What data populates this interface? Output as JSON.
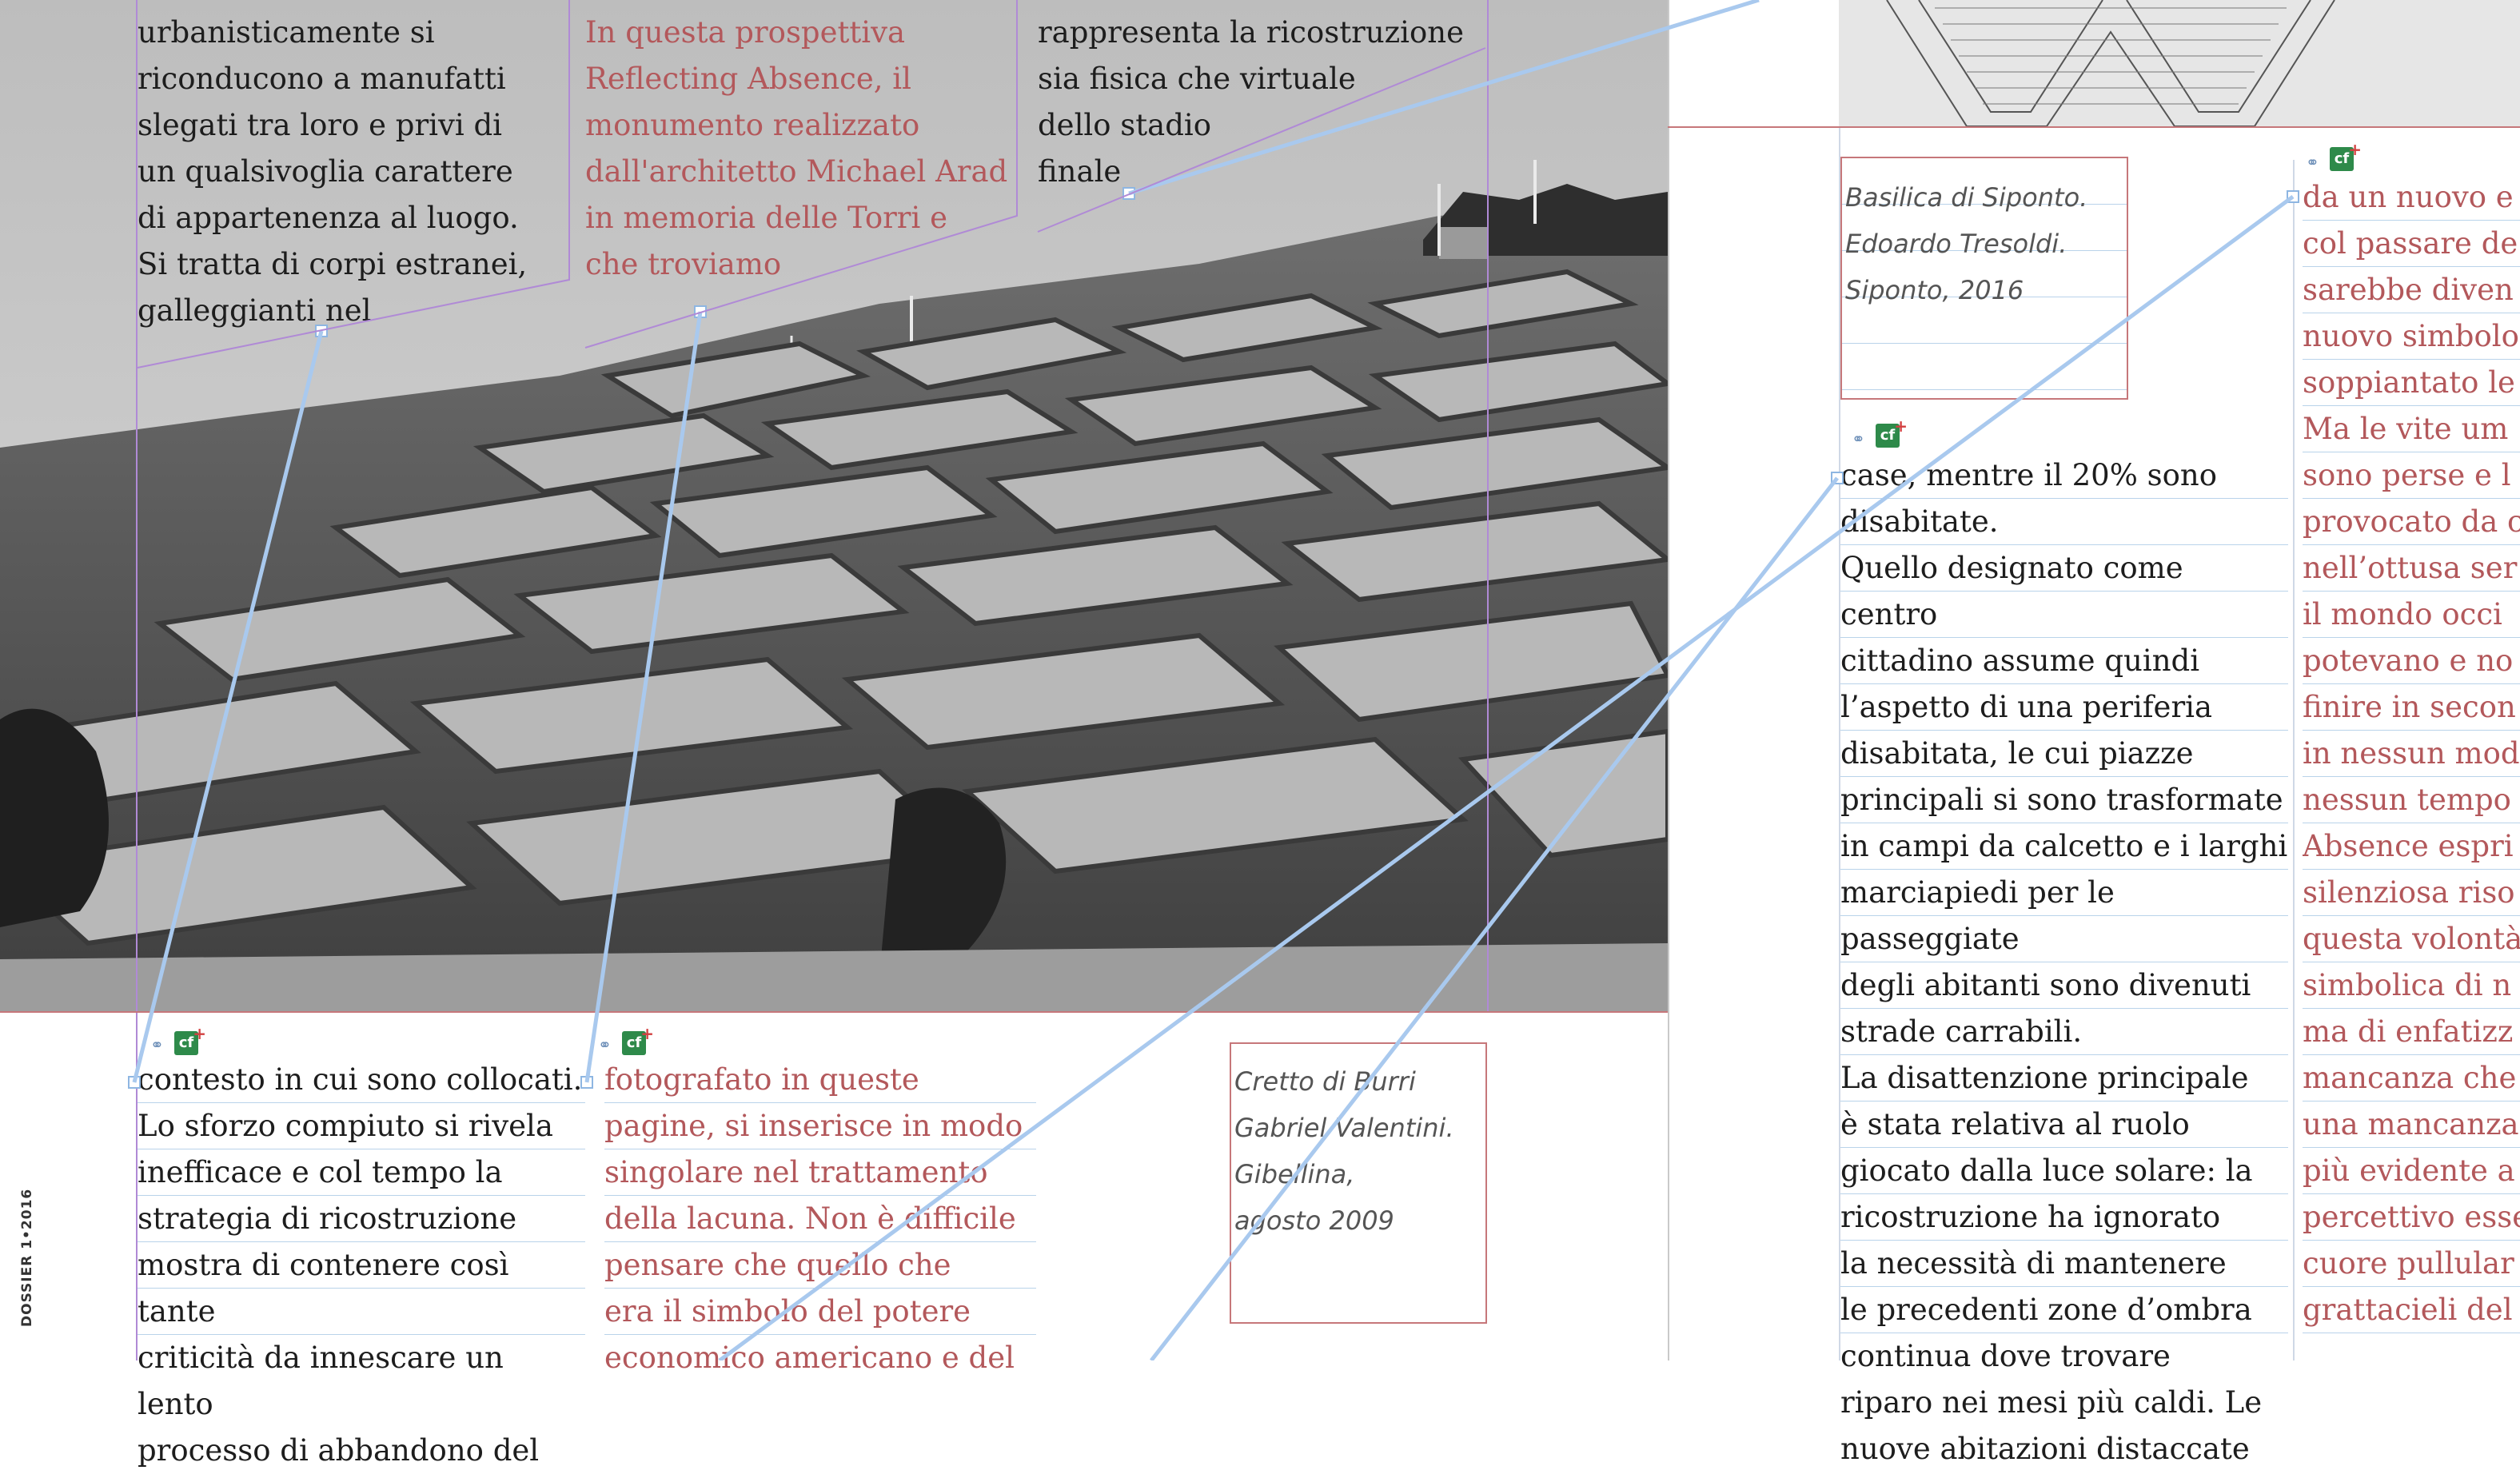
{
  "spread": {
    "folio": "DOSSIER 1•2016"
  },
  "left_page": {
    "top_frame_1": "urbanisticamente si\nriconducono a manufatti\nslegati tra loro e privi di\nun qualsivoglia carattere\ndi appartenenza al luogo.\nSi tratta di corpi estranei,\ngalleggianti nel",
    "top_frame_2": "In questa prospettiva\nReflecting Absence, il\nmonumento realizzato\ndall'architetto Michael Arad\nin memoria delle Torri e\nche troviamo",
    "top_frame_3": "rappresenta la ricostruzione\nsia fisica che virtuale\ndello stadio\nfinale",
    "bottom_frame_1": "contesto in cui sono collocati.\nLo sforzo compiuto si rivela\ninefficace e col tempo la\nstrategia di ricostruzione\nmostra di contenere così tante\ncriticità da innescare un lento\nprocesso di abbandono del",
    "bottom_frame_2": "fotografato in queste\npagine, si inserisce in modo\nsingolare nel trattamento\ndella lacuna. Non è difficile\npensare che quello che\nera il simbolo del potere\neconomico americano e del",
    "caption": {
      "line1": "Cretto di Burri",
      "line2": "Gabriel Valentini.",
      "line3": "Gibellina,",
      "line4": "agosto 2009"
    }
  },
  "right_page": {
    "caption": {
      "line1": "Basilica di Siponto.",
      "line2": "Edoardo Tresoldi.",
      "line3": "Siponto, 2016"
    },
    "body_col_1": "case, mentre il 20% sono\ndisabitate.\nQuello designato come centro\ncittadino assume quindi\nl’aspetto di una periferia\ndisabitata, le cui piazze\nprincipali si sono trasformate\nin campi da calcetto e i larghi\nmarciapiedi per le passeggiate\ndegli abitanti sono divenuti\nstrade carrabili.\nLa disattenzione principale\nè stata relativa al ruolo\ngiocato dalla luce solare: la\nricostruzione ha ignorato\nla necessità di mantenere\nle precedenti zone d’ombra\ncontinua dove trovare\nriparo nei mesi più caldi. Le\nnuove abitazioni distaccate",
    "body_col_2": "da un nuovo e\ncol passare de\nsarebbe diven\nnuovo simbolo\nsoppiantato le\nMa le vite um\nsono perse e l\nprovocato da c\nnell’ottusa ser\nil mondo occi\npotevano e no\nfinire in secon\nin nessun mod\nnessun tempo\nAbsence espri\nsilenziosa riso\nquesta volontà\nsimbolica di n\nma di enfatizz\nmancanza che\nuna mancanza\npiù evidente a\npercettivo esse\ncuore pullular\ngrattacieli del"
  },
  "icons": {
    "link": "link-icon",
    "badge": "cc-badge-icon",
    "badge_text": "cf"
  }
}
